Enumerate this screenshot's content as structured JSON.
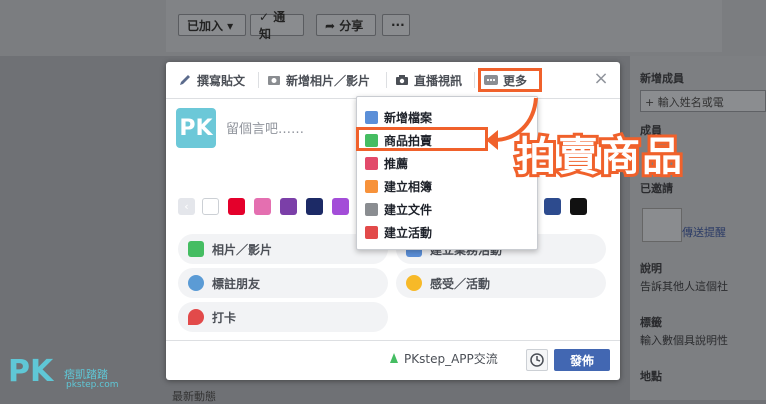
{
  "background": {
    "top_buttons": {
      "joined": "已加入 ▾",
      "notify": "✓ 通知",
      "share": "➦ 分享",
      "more": "···"
    },
    "sidebar": {
      "new_member": "新增成員",
      "input_placeholder": "+ 輸入姓名或電",
      "members": "成員",
      "invited": "已邀請",
      "send_reminder": "傳送提醒",
      "description": "說明",
      "description_text": "告訴其他人這個社",
      "tags": "標籤",
      "tags_text": "輸入數個具說明性",
      "location": "地點"
    },
    "bottom_text": "最新動態"
  },
  "composer": {
    "tabs": [
      {
        "label": "撰寫貼文",
        "icon": "pencil-icon"
      },
      {
        "label": "新增相片／影片",
        "icon": "camera-icon"
      },
      {
        "label": "直播視訊",
        "icon": "video-camera-icon"
      },
      {
        "label": "更多",
        "icon": "more-dots-icon"
      }
    ],
    "close_icon": "close-icon",
    "avatar_text": "PK",
    "placeholder": "留個言吧……",
    "swatch_colors": [
      "#ffffff",
      "#e4e6eb",
      "#e4002b",
      "#e46fb0",
      "#7b3fa8",
      "#1c2a66",
      "#a34dd8",
      "#d61a5a",
      "#2d4b8e",
      "#111111",
      "#111111"
    ],
    "chips": [
      {
        "label": "相片／影片",
        "color": "#45bd62"
      },
      {
        "label": "建立業務活動",
        "color": "#5b8fd8"
      },
      {
        "label": "標註朋友",
        "color": "#5b9bd5"
      },
      {
        "label": "感受／活動",
        "color": "#f7b928"
      },
      {
        "label": "打卡",
        "color": "#e24a4a"
      }
    ],
    "audience": "PKstep_APP交流",
    "post_button": "發佈"
  },
  "dropdown": {
    "items": [
      {
        "label": "新增檔案",
        "icon": "file-add-icon",
        "color": "#5b8fd8"
      },
      {
        "label": "商品拍賣",
        "icon": "price-tag-icon",
        "color": "#45bd62"
      },
      {
        "label": "推薦",
        "icon": "recommend-icon",
        "color": "#e24a6a"
      },
      {
        "label": "建立相簿",
        "icon": "album-icon",
        "color": "#f7923a"
      },
      {
        "label": "建立文件",
        "icon": "document-icon",
        "color": "#8a8d91"
      },
      {
        "label": "建立活動",
        "icon": "calendar-icon",
        "color": "#e24a4a"
      }
    ]
  },
  "annotation": "拍賣商品",
  "watermark": {
    "logo": "PK",
    "name": "痞凱踏踏",
    "site": "pkstep.com"
  },
  "accent_color": "#f0612b"
}
